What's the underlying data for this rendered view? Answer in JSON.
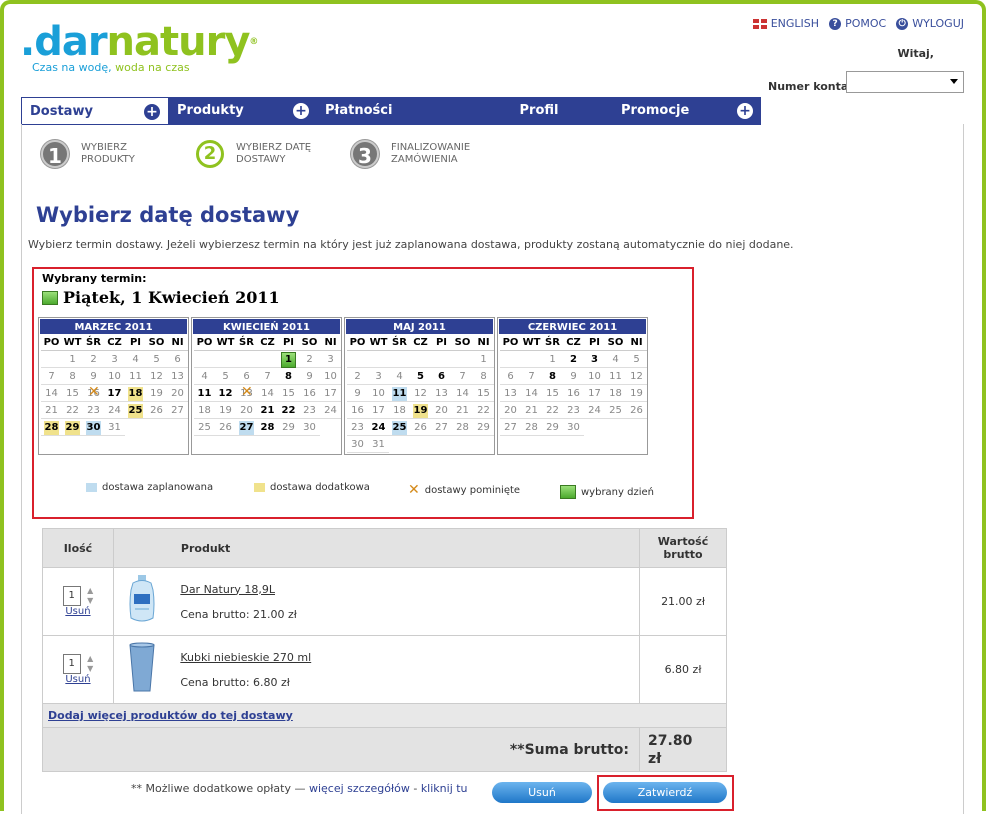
{
  "brand": {
    "logo_part1": ".dar",
    "logo_part2": "natury",
    "tag_part1": "Czas na wodę, ",
    "tag_part2": "woda na czas"
  },
  "topbar": {
    "english": "ENGLISH",
    "help": "POMOC",
    "logout": "WYLOGUJ",
    "welcome": "Witaj,",
    "account_label": "Numer konta:",
    "account_value": ""
  },
  "nav": [
    "Dostawy",
    "Produkty",
    "Płatności",
    "Profil",
    "Promocje"
  ],
  "steps": [
    {
      "num": "1",
      "line1": "WYBIERZ",
      "line2": "PRODUKTY"
    },
    {
      "num": "2",
      "line1": "WYBIERZ DATĘ",
      "line2": "DOSTAWY"
    },
    {
      "num": "3",
      "line1": "FINALIZOWANIE",
      "line2": "ZAMÓWIENIA"
    }
  ],
  "page": {
    "title": "Wybierz datę dostawy",
    "intro": "Wybierz termin dostawy. Jeżeli wybierzesz termin na który jest już zaplanowana dostawa, produkty zostaną automatycznie do niej dodane."
  },
  "calendar": {
    "selected_label": "Wybrany termin:",
    "selected_date": "Piątek, 1 Kwiecień 2011",
    "dow": [
      "PO",
      "WT",
      "ŚR",
      "CZ",
      "PI",
      "SO",
      "NI"
    ],
    "months": [
      {
        "name": "MARZEC 2011",
        "lead": 1,
        "days": 31,
        "bold": [
          17,
          18,
          25,
          28,
          29,
          30
        ],
        "planned": [
          30
        ],
        "extra": [
          18,
          25,
          28,
          29
        ],
        "skipped": [
          16
        ],
        "selected": []
      },
      {
        "name": "KWIECIEŃ 2011",
        "lead": 4,
        "days": 30,
        "bold": [
          1,
          8,
          11,
          12,
          21,
          22,
          27,
          28
        ],
        "planned": [
          27
        ],
        "extra": [],
        "skipped": [
          13
        ],
        "selected": [
          1
        ]
      },
      {
        "name": "MAJ 2011",
        "lead": 6,
        "days": 31,
        "bold": [
          5,
          6,
          11,
          19,
          24,
          25
        ],
        "planned": [
          11,
          25
        ],
        "extra": [
          19
        ],
        "skipped": [],
        "selected": []
      },
      {
        "name": "CZERWIEC 2011",
        "lead": 2,
        "days": 30,
        "bold": [
          2,
          3,
          8
        ],
        "planned": [],
        "extra": [],
        "skipped": [],
        "selected": []
      }
    ],
    "legend": {
      "planned": "dostawa zaplanowana",
      "extra": "dostawa dodatkowa",
      "skipped": "dostawy pominięte",
      "selected": "wybrany dzień"
    },
    "colors": {
      "planned": "#bfdcef",
      "extra": "#f0e28c",
      "skipped": "#d48a1a",
      "selected": "#4caa2e"
    }
  },
  "table": {
    "headers": {
      "qty": "Ilość",
      "product": "Produkt",
      "value_line1": "Wartość",
      "value_line2": "brutto"
    },
    "rows": [
      {
        "qty": "1",
        "remove": "Usuń",
        "name": "Dar Natury 18,9L",
        "price": "Cena brutto: 21.00 zł",
        "value": "21.00 zł",
        "icon": "water-bottle-icon"
      },
      {
        "qty": "1",
        "remove": "Usuń",
        "name": "Kubki niebieskie 270 ml",
        "price": "Cena brutto: 6.80 zł",
        "value": "6.80 zł",
        "icon": "blue-cup-icon"
      }
    ],
    "add_more": "Dodaj więcej produktów do tej dostawy",
    "sum_label": "**Suma brutto:",
    "sum_value_line1": "27.80",
    "sum_value_line2": "zł"
  },
  "footer": {
    "note_prefix": "** Możliwe dodatkowe opłaty — ",
    "more_details": "więcej szczegółów",
    "sep": " - ",
    "click_here": "kliknij tu",
    "remove_btn": "Usuń",
    "confirm_btn": "Zatwierdź"
  }
}
